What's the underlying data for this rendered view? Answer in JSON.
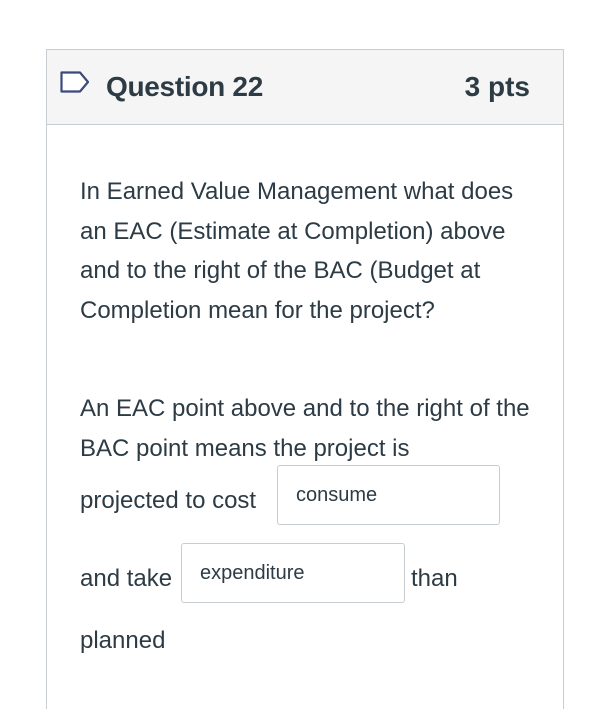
{
  "question": {
    "title": "Question 22",
    "points": "3 pts",
    "flag_icon": "bookmark-flag-icon"
  },
  "body": {
    "prompt": "In Earned Value Management what does an EAC (Estimate at Completion) above and to the right of the BAC (Budget at Completion mean for the project?",
    "answer_intro": "An EAC point above and to the right of the BAC point means the project is",
    "segment_1": "projected to cost",
    "blank_1_value": "consume",
    "segment_2": "and take",
    "blank_2_value": "expenditure",
    "segment_3": "than",
    "segment_4": "planned"
  },
  "colors": {
    "header_bg": "#f5f5f5",
    "border": "#c7cdd1",
    "text": "#2d3b45"
  }
}
